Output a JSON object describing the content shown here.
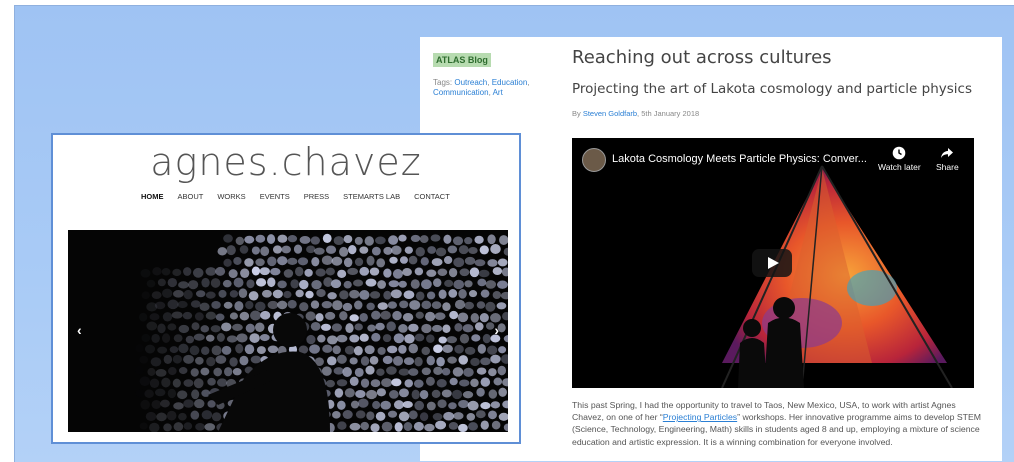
{
  "blog": {
    "badge": "ATLAS Blog",
    "tags_prefix": "Tags: ",
    "tags": [
      "Outreach",
      "Education",
      "Communication",
      "Art"
    ],
    "title": "Reaching out across cultures",
    "subtitle": "Projecting the art of Lakota cosmology and particle physics",
    "byline_prefix": "By ",
    "author": "Steven Goldfarb",
    "date": ", 5th January 2018",
    "video": {
      "title": "Lakota Cosmology Meets Particle Physics: Conver...",
      "watch_later": "Watch later",
      "share": "Share"
    },
    "paragraph_before": "This past Spring, I had the opportunity to travel to Taos, New Mexico, USA, to work with artist Agnes Chavez, on one of her “",
    "paragraph_link": "Projecting Particles",
    "paragraph_after": "” workshops. Her innovative programme aims to develop STEM (Science, Technology, Engineering, Math) skills in students aged 8 and up, employing a mixture of science education and artistic expression. It is a winning combination for everyone involved."
  },
  "agnes": {
    "logo": "agnes.chavez",
    "nav": [
      "HOME",
      "ABOUT",
      "WORKS",
      "EVENTS",
      "PRESS",
      "STEMARTS LAB",
      "CONTACT"
    ],
    "prev": "‹",
    "next": "›"
  }
}
